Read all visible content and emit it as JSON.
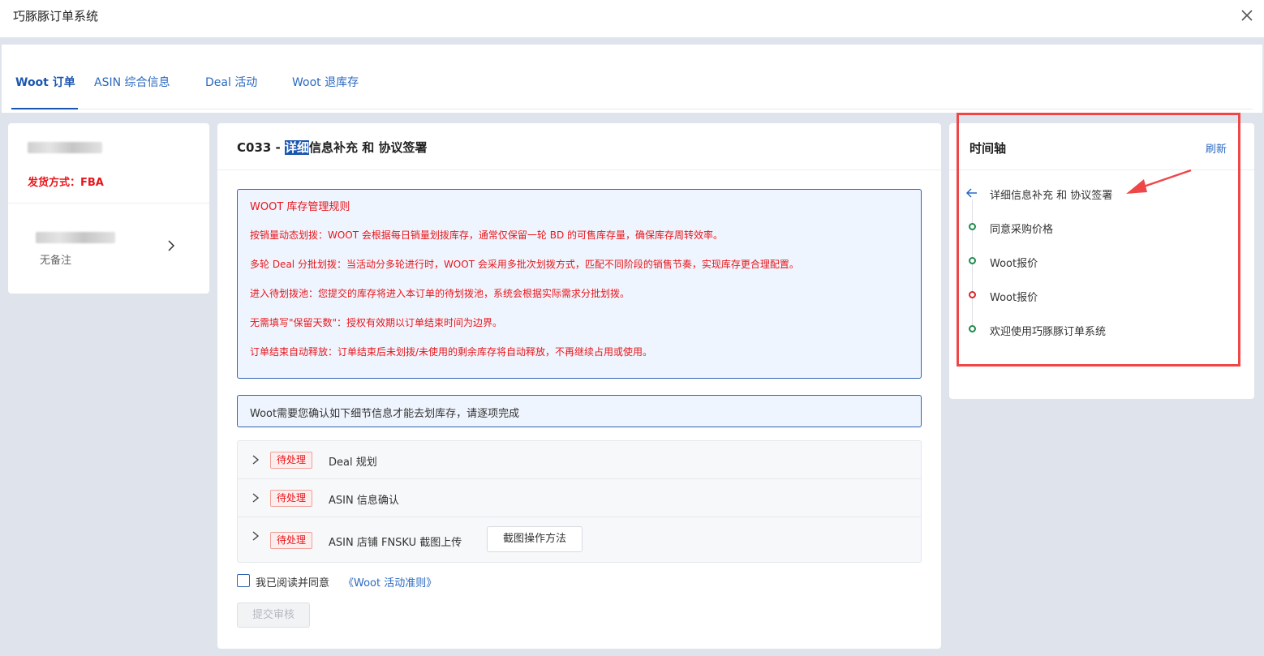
{
  "window": {
    "title": "巧豚豚订单系统",
    "close_icon": "close-icon"
  },
  "tabs": [
    {
      "label": "Woot 订单",
      "active": true
    },
    {
      "label": "ASIN 综合信息",
      "active": false
    },
    {
      "label": "Deal 活动",
      "active": false
    },
    {
      "label": "Woot 退库存",
      "active": false
    }
  ],
  "left_panel": {
    "shipping": "发货方式：FBA",
    "note": "无备注"
  },
  "main": {
    "heading_prefix": "C033 - ",
    "heading_highlight": "详细",
    "heading_rest": "信息补充 和 协议签署",
    "rules_title": "WOOT 库存管理规则",
    "rules": [
      "按销量动态划拨：WOOT 会根据每日销量划拨库存，通常仅保留一轮 BD 的可售库存量，确保库存周转效率。",
      "多轮 Deal 分批划拨：当活动分多轮进行时，WOOT 会采用多批次划拨方式，匹配不同阶段的销售节奏，实现库存更合理配置。",
      "进入待划拨池：您提交的库存将进入本订单的待划拨池，系统会根据实际需求分批划拨。",
      "无需填写\"保留天数\"：授权有效期以订单结束时间为边界。",
      "订单结束自动释放：订单结束后未划拨/未使用的剩余库存将自动释放，不再继续占用或使用。"
    ],
    "confirm_text": "Woot需要您确认如下细节信息才能去划库存，请逐项完成",
    "items": [
      {
        "status": "待处理",
        "label": "Deal 规划"
      },
      {
        "status": "待处理",
        "label": "ASIN 信息确认"
      },
      {
        "status": "待处理",
        "label": "ASIN 店铺 FNSKU 截图上传",
        "button": "截图操作方法"
      }
    ],
    "agree_text": "我已阅读并同意",
    "agree_link": "《Woot 活动准则》",
    "agree_checked": false,
    "submit_label": "提交审核"
  },
  "timeline": {
    "title": "时间轴",
    "refresh_label": "刷新",
    "items": [
      {
        "text": "详细信息补充 和 协议签署",
        "marker": "arrow-left-icon",
        "color": "#2a69c0"
      },
      {
        "text": "同意采购价格",
        "marker": "dot",
        "color": "#1f8a4c"
      },
      {
        "text": "Woot报价",
        "marker": "dot",
        "color": "#1f8a4c"
      },
      {
        "text": "Woot报价",
        "marker": "dot",
        "color": "#d8262b"
      },
      {
        "text": "欢迎使用巧豚豚订单系统",
        "marker": "dot",
        "color": "#1f8a4c"
      }
    ]
  },
  "annotation": {
    "color": "#ef4747",
    "shapes": [
      "highlight-box",
      "pointer-arrow"
    ]
  }
}
